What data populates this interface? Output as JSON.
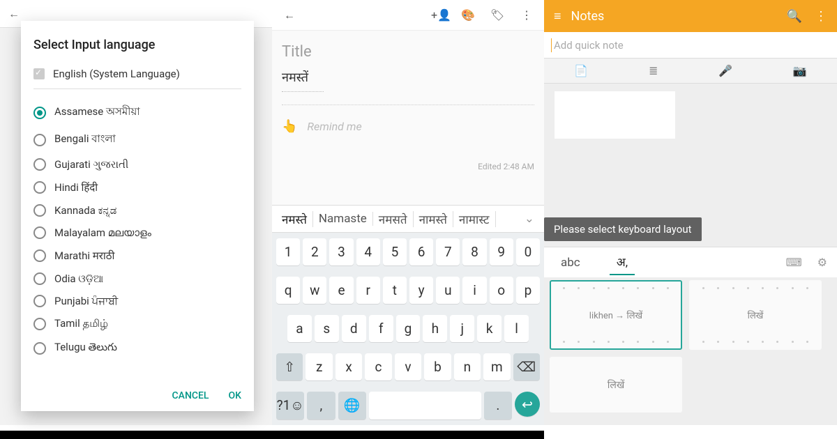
{
  "panel1": {
    "dialog_title": "Select Input language",
    "system_lang": "English (System Language)",
    "languages": [
      "Assamese অসমীয়া",
      "Bengali বাংলা",
      "Gujarati ગુજરાતી",
      "Hindi हिंदी",
      "Kannada ಕನ್ನಡ",
      "Malayalam മലയാളം",
      "Marathi मराठी",
      "Odia ଓଡ଼ିଆ",
      "Punjabi ਪੰਜਾਬੀ",
      "Tamil தமிழ்",
      "Telugu తెలుగు"
    ],
    "selected_index": 0,
    "cancel": "CANCEL",
    "ok": "OK"
  },
  "panel2": {
    "title_placeholder": "Title",
    "body": "नमस्तें",
    "remind": "Remind me",
    "edited": "Edited 2:48 AM",
    "suggestions": [
      "नमस्ते",
      "Namaste",
      "नमसते",
      "नामस्ते",
      "नामास्ट"
    ],
    "keys": {
      "row1": [
        "1",
        "2",
        "3",
        "4",
        "5",
        "6",
        "7",
        "8",
        "9",
        "0"
      ],
      "row2": [
        "q",
        "w",
        "e",
        "r",
        "t",
        "y",
        "u",
        "i",
        "o",
        "p"
      ],
      "row3": [
        "a",
        "s",
        "d",
        "f",
        "g",
        "h",
        "j",
        "k",
        "l"
      ],
      "row4_shift": "⇧",
      "row4": [
        "z",
        "x",
        "c",
        "v",
        "b",
        "n",
        "m"
      ],
      "row4_back": "⌫",
      "row5_sym": "?1☺",
      "row5_comma": ",",
      "row5_globe": "🌐",
      "row5_dot": ".",
      "row5_enter": "↩"
    }
  },
  "panel3": {
    "app_title": "Notes",
    "quick_placeholder": "Add quick note",
    "tooltip": "Please select keyboard layout",
    "tab_abc": "abc",
    "tab_native": "अ,",
    "layout1_mid": "likhen → लिखें",
    "layout2_mid": "लिखें",
    "layout3_mid": "लिखें"
  }
}
